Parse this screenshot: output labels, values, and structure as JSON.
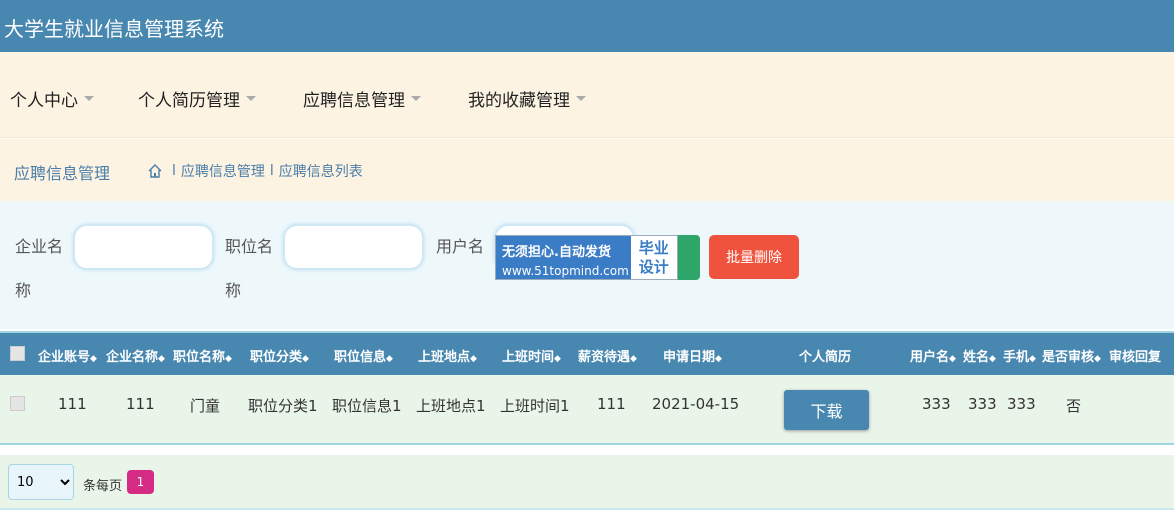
{
  "app": {
    "title": "大学生就业信息管理系统"
  },
  "nav": [
    {
      "label": "个人中心"
    },
    {
      "label": "个人简历管理"
    },
    {
      "label": "应聘信息管理"
    },
    {
      "label": "我的收藏管理"
    }
  ],
  "breadcrumb": {
    "title": "应聘信息管理",
    "path": [
      "应聘信息管理",
      "应聘信息列表"
    ],
    "sep": "l"
  },
  "search": {
    "fields": [
      {
        "label": "企业名称",
        "value": "",
        "placeholder": ""
      },
      {
        "label": "职位名称",
        "value": "",
        "placeholder": ""
      },
      {
        "label": "用户名",
        "value": "",
        "placeholder": ""
      }
    ],
    "ad": {
      "line1": "无须担心.自动发货",
      "line2": "www.51topmind.com",
      "right1": "毕业",
      "right2": "设计"
    },
    "batch_delete": "批量删除"
  },
  "table": {
    "columns": [
      "企业账号",
      "企业名称",
      "职位名称",
      "职位分类",
      "职位信息",
      "上班地点",
      "上班时间",
      "薪资待遇",
      "申请日期",
      "个人简历",
      "用户名",
      "姓名",
      "手机",
      "是否审核",
      "审核回复"
    ],
    "sort_icon": "◆",
    "rows": [
      {
        "company_account": "111",
        "company_name": "111",
        "job_name": "门童",
        "job_category": "职位分类1",
        "job_info": "职位信息1",
        "work_place": "上班地点1",
        "work_time": "上班时间1",
        "salary": "111",
        "apply_date": "2021-04-15",
        "resume_button": "下载",
        "username": "333",
        "name": "333",
        "phone": "333",
        "reviewed": "否",
        "reply": ""
      }
    ]
  },
  "pager": {
    "page_size": "10",
    "per_page_text": "条每页",
    "current_page": "1"
  }
}
